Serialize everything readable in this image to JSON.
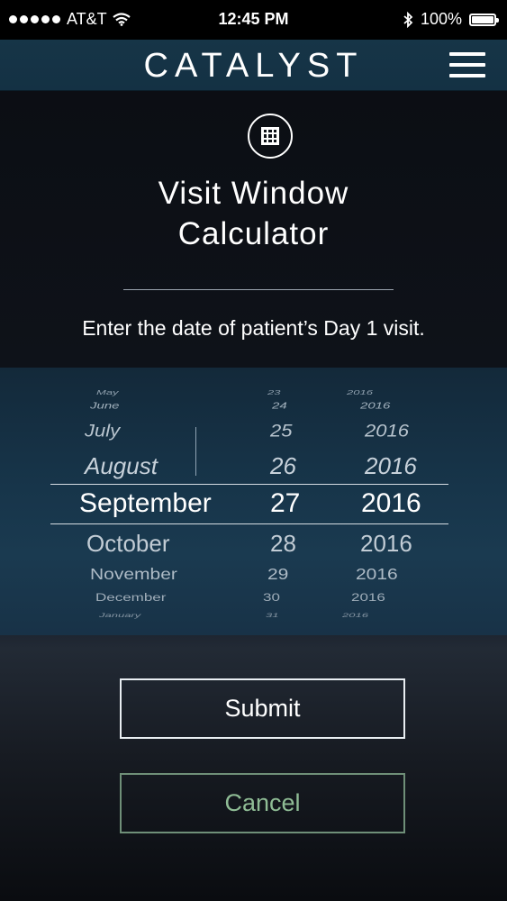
{
  "status_bar": {
    "carrier": "AT&T",
    "time": "12:45 PM",
    "battery": "100%",
    "battery_level": 1.0,
    "icons": [
      "signal-dots-icon",
      "wifi-icon",
      "bluetooth-icon",
      "battery-icon"
    ]
  },
  "header": {
    "brand": "CATALYST",
    "menu_icon": "hamburger-menu-icon"
  },
  "page": {
    "icon": "calculator-icon",
    "title_line1": "Visit Window",
    "title_line2": "Calculator",
    "instruction": "Enter the date of patient’s Day 1 visit."
  },
  "date_picker": {
    "rows": [
      {
        "month": "May",
        "day": "23",
        "year": "2016"
      },
      {
        "month": "June",
        "day": "24",
        "year": "2016"
      },
      {
        "month": "July",
        "day": "25",
        "year": "2016"
      },
      {
        "month": "August",
        "day": "26",
        "year": "2016"
      },
      {
        "month": "September",
        "day": "27",
        "year": "2016"
      },
      {
        "month": "October",
        "day": "28",
        "year": "2016"
      },
      {
        "month": "November",
        "day": "29",
        "year": "2016"
      },
      {
        "month": "December",
        "day": "30",
        "year": "2016"
      },
      {
        "month": "January",
        "day": "31",
        "year": "2016"
      }
    ],
    "selected": {
      "month": "September",
      "day": "27",
      "year": "2016"
    }
  },
  "buttons": {
    "submit": "Submit",
    "cancel": "Cancel"
  },
  "colors": {
    "header_bg": "#163547",
    "picker_bg": "#17354a",
    "cancel_text": "#8fbc95",
    "cancel_border": "#6f8f78"
  }
}
